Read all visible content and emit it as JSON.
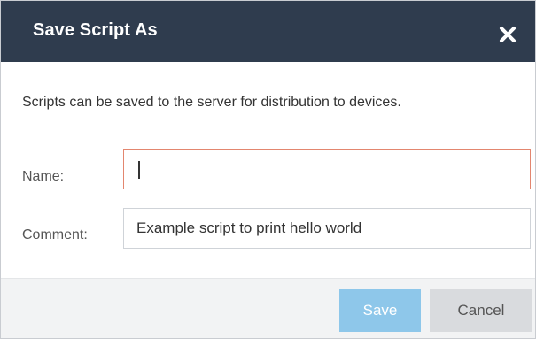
{
  "dialog": {
    "title": "Save Script As",
    "description": "Scripts can be saved to the server for distribution to devices.",
    "fields": {
      "name": {
        "label": "Name:",
        "value": ""
      },
      "comment": {
        "label": "Comment:",
        "value": "Example script to print hello world"
      }
    },
    "buttons": {
      "save_label": "Save",
      "cancel_label": "Cancel"
    },
    "icons": {
      "close": "close-icon"
    }
  },
  "colors": {
    "titlebar": "#2f3c4e",
    "save_button": "#8ec7ea",
    "cancel_button": "#d9dbde",
    "focused_input_border": "#e3866f"
  }
}
